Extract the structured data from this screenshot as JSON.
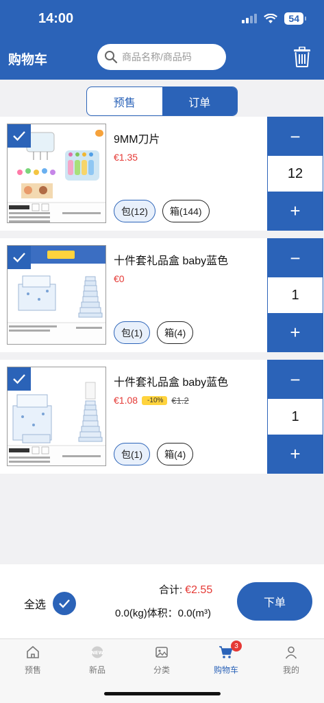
{
  "status": {
    "time": "14:00",
    "battery": "54"
  },
  "header": {
    "title": "购物车",
    "search_placeholder": "商品名称/商品码"
  },
  "tabs": [
    {
      "label": "预售",
      "active": false
    },
    {
      "label": "订单",
      "active": true
    }
  ],
  "items": [
    {
      "name": "9MM刀片",
      "price": "€1.35",
      "discount": "",
      "old_price": "",
      "units": [
        {
          "label": "包(12)",
          "selected": true
        },
        {
          "label": "箱(144)",
          "selected": false
        }
      ],
      "quantity": "12",
      "checked": true
    },
    {
      "name": "十件套礼品盒 baby蓝色",
      "price": "€0",
      "discount": "",
      "old_price": "",
      "units": [
        {
          "label": "包(1)",
          "selected": true
        },
        {
          "label": "箱(4)",
          "selected": false
        }
      ],
      "quantity": "1",
      "checked": true
    },
    {
      "name": "十件套礼品盒 baby蓝色",
      "price": "€1.08",
      "discount": "-10%",
      "old_price": "€1.2",
      "units": [
        {
          "label": "包(1)",
          "selected": true
        },
        {
          "label": "箱(4)",
          "selected": false
        }
      ],
      "quantity": "1",
      "checked": true
    }
  ],
  "stepper": {
    "minus": "−",
    "plus": "+"
  },
  "footer": {
    "select_all": "全选",
    "total_label": "合计:",
    "total_amount": "€2.55",
    "volume": "0.0(kg)体积：0.0(m³)",
    "order_button": "下单"
  },
  "tabbar": [
    {
      "label": "预售",
      "icon": "home-icon"
    },
    {
      "label": "新品",
      "icon": "new-icon"
    },
    {
      "label": "分类",
      "icon": "image-icon"
    },
    {
      "label": "购物车",
      "icon": "cart-icon",
      "badge": "3",
      "active": true
    },
    {
      "label": "我的",
      "icon": "user-icon"
    }
  ],
  "colors": {
    "primary": "#2b63b8",
    "price": "#e53935",
    "discount_bg": "#ffd33d"
  }
}
